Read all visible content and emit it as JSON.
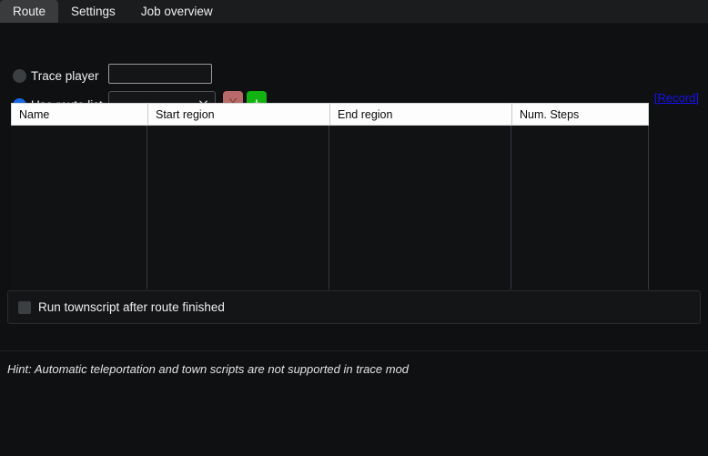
{
  "window": {
    "title": "Route"
  },
  "tabs": [
    {
      "label": "Route",
      "selected": true
    },
    {
      "label": "Settings",
      "selected": false
    },
    {
      "label": "Job overview",
      "selected": false
    }
  ],
  "mode": {
    "trace_player": {
      "label": "Trace player",
      "selected": false,
      "input_value": "",
      "input_placeholder": ""
    },
    "use_route_list": {
      "label": "Use route list",
      "selected": true,
      "combo_value": "",
      "combo_options": [],
      "delete_button_label": "X",
      "delete_icon": "close-icon",
      "add_button_label": "+",
      "add_icon": "plus-icon",
      "chevron_icon": "chevron-down-icon"
    }
  },
  "record_link": {
    "label": "[Record]",
    "color": "#1512f0"
  },
  "table": {
    "columns": [
      "Name",
      "Start region",
      "End region",
      "Num. Steps"
    ],
    "rows": []
  },
  "options": {
    "run_townscript": {
      "label": "Run townscript after route finished",
      "checked": false
    }
  },
  "footer": {
    "hint": "Hint: Automatic teleportation and town scripts are not supported in trace mod"
  },
  "colors": {
    "accent_radio": "#1668e3",
    "add_button": "#12b212",
    "delete_button": "#b96a68",
    "link": "#1512f0",
    "background": "#0f1011",
    "tab_selected": "#3a3b3d"
  }
}
